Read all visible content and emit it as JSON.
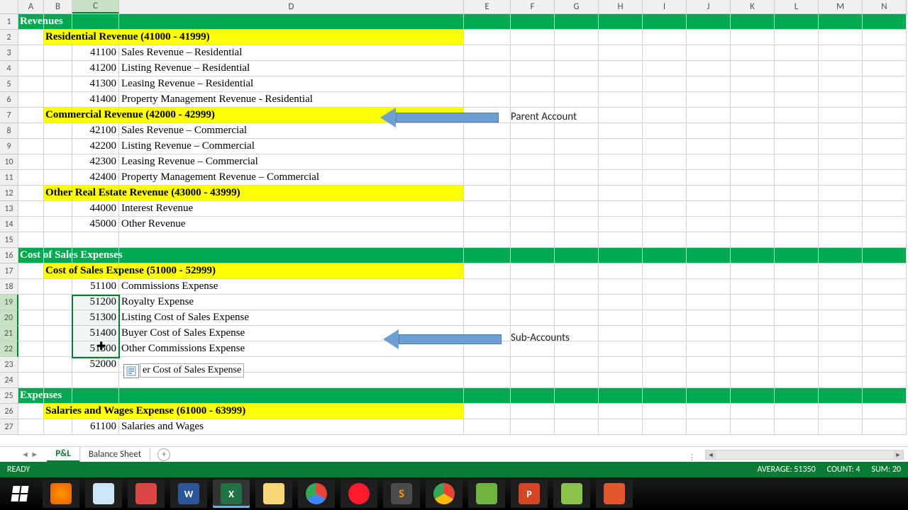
{
  "columns": [
    "A",
    "B",
    "C",
    "D",
    "E",
    "F",
    "G",
    "H",
    "I",
    "J",
    "K",
    "L",
    "M",
    "N"
  ],
  "rows": [
    {
      "n": 1,
      "type": "green",
      "a": "Revenues"
    },
    {
      "n": 2,
      "type": "yellow",
      "b": "Residential Revenue (41000 - 41999)"
    },
    {
      "n": 3,
      "type": "data",
      "c": "41100",
      "d": "Sales Revenue – Residential"
    },
    {
      "n": 4,
      "type": "data",
      "c": "41200",
      "d": "Listing Revenue – Residential"
    },
    {
      "n": 5,
      "type": "data",
      "c": "41300",
      "d": "Leasing Revenue – Residential"
    },
    {
      "n": 6,
      "type": "data",
      "c": "41400",
      "d": "Property Management Revenue - Residential"
    },
    {
      "n": 7,
      "type": "yellow",
      "b": "Commercial Revenue (42000 - 42999)"
    },
    {
      "n": 8,
      "type": "data",
      "c": "42100",
      "d": "Sales Revenue – Commercial"
    },
    {
      "n": 9,
      "type": "data",
      "c": "42200",
      "d": "Listing Revenue – Commercial"
    },
    {
      "n": 10,
      "type": "data",
      "c": "42300",
      "d": "Leasing Revenue – Commercial"
    },
    {
      "n": 11,
      "type": "data",
      "c": "42400",
      "d": "Property Management Revenue – Commercial"
    },
    {
      "n": 12,
      "type": "yellow",
      "b": "Other Real Estate Revenue (43000 - 43999)"
    },
    {
      "n": 13,
      "type": "data",
      "c": "44000",
      "d": "Interest Revenue"
    },
    {
      "n": 14,
      "type": "data",
      "c": "45000",
      "d": "Other Revenue"
    },
    {
      "n": 15,
      "type": "blank"
    },
    {
      "n": 16,
      "type": "green",
      "a": "Cost of Sales Expenses"
    },
    {
      "n": 17,
      "type": "yellow",
      "b": "Cost of Sales Expense (51000 - 52999)"
    },
    {
      "n": 18,
      "type": "data",
      "c": "51100",
      "d": "Commissions Expense"
    },
    {
      "n": 19,
      "type": "data",
      "c": "51200",
      "d": "Royalty Expense"
    },
    {
      "n": 20,
      "type": "data",
      "c": "51300",
      "d": "Listing Cost of Sales Expense"
    },
    {
      "n": 21,
      "type": "data",
      "c": "51400",
      "d": "Buyer Cost of Sales Expense"
    },
    {
      "n": 22,
      "type": "data",
      "c": "51500",
      "d": "Other Commissions Expense"
    },
    {
      "n": 23,
      "type": "data",
      "c": "52000",
      "d": ""
    },
    {
      "n": 24,
      "type": "blank"
    },
    {
      "n": 25,
      "type": "green",
      "a": "Expenses"
    },
    {
      "n": 26,
      "type": "yellow",
      "b": "Salaries and Wages Expense (61000 - 63999)"
    },
    {
      "n": 27,
      "type": "data",
      "c": "61100",
      "d": "Salaries and Wages"
    }
  ],
  "tooltip_text": "er Cost of Sales Expense",
  "arrows": {
    "parent": "Parent Account",
    "sub": "Sub-Accounts"
  },
  "tabs": {
    "active": "P&L",
    "other": "Balance Sheet"
  },
  "status": {
    "left": "READY",
    "avg": "AVERAGE: 51350",
    "count": "COUNT: 4",
    "sum_partial": "SUM: 20"
  },
  "selected_column": "C",
  "selected_rows": [
    19,
    20,
    21,
    22
  ]
}
